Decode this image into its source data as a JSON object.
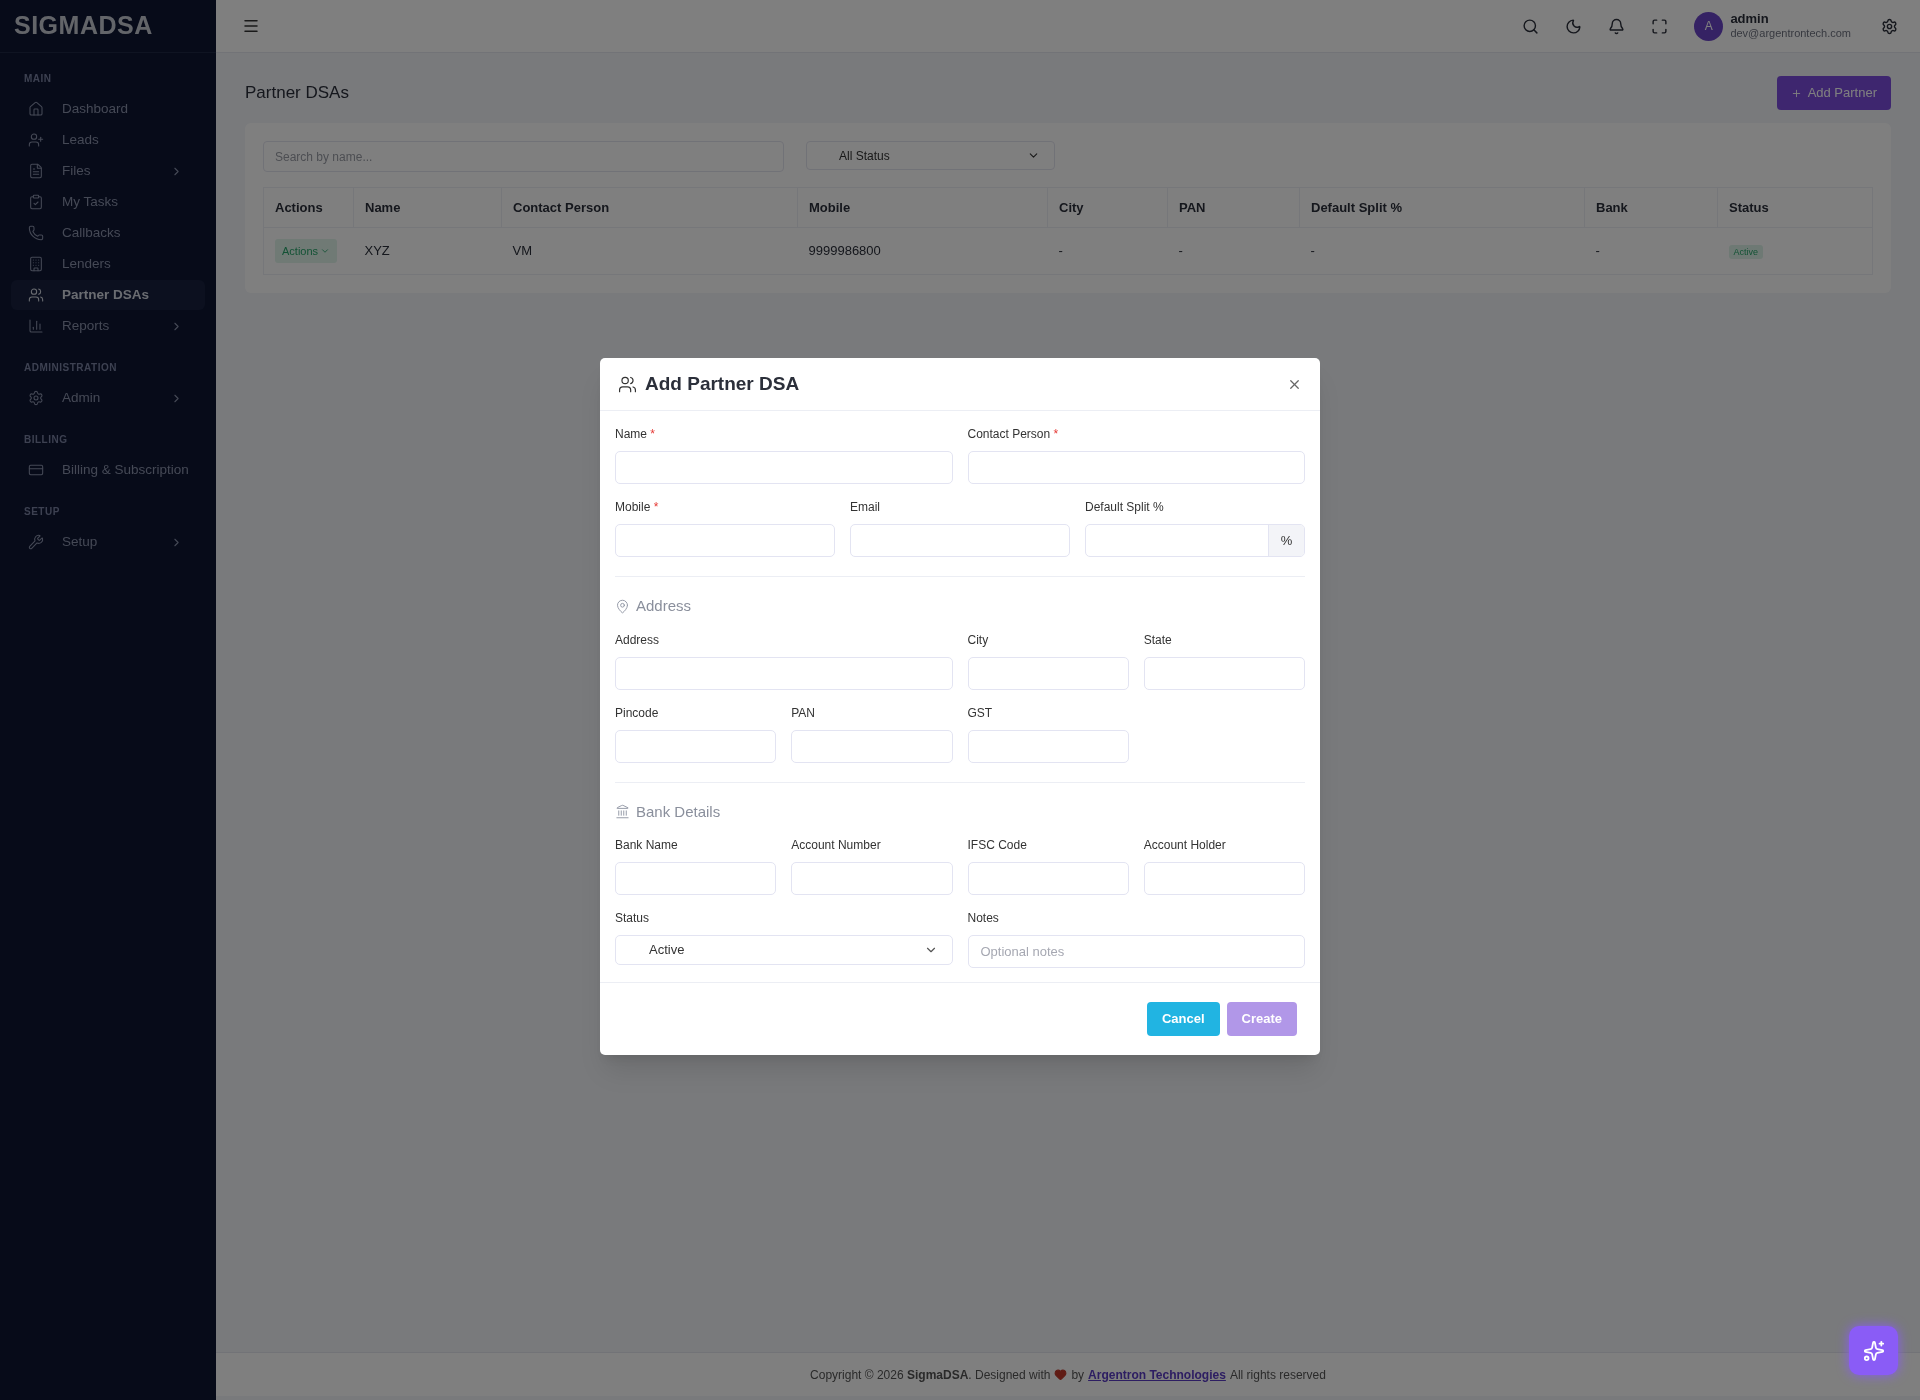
{
  "brand": "SIGMADSA",
  "sidebar": {
    "sections": [
      {
        "heading": "MAIN",
        "items": [
          {
            "label": "Dashboard",
            "submenu": false,
            "selected": false
          },
          {
            "label": "Leads",
            "submenu": false,
            "selected": false
          },
          {
            "label": "Files",
            "submenu": true,
            "selected": false
          },
          {
            "label": "My Tasks",
            "submenu": false,
            "selected": false
          },
          {
            "label": "Callbacks",
            "submenu": false,
            "selected": false
          },
          {
            "label": "Lenders",
            "submenu": false,
            "selected": false
          },
          {
            "label": "Partner DSAs",
            "submenu": false,
            "selected": true
          },
          {
            "label": "Reports",
            "submenu": true,
            "selected": false
          }
        ]
      },
      {
        "heading": "ADMINISTRATION",
        "items": [
          {
            "label": "Admin",
            "submenu": true,
            "selected": false
          }
        ]
      },
      {
        "heading": "BILLING",
        "items": [
          {
            "label": "Billing & Subscription",
            "submenu": false,
            "selected": false
          }
        ]
      },
      {
        "heading": "SETUP",
        "items": [
          {
            "label": "Setup",
            "submenu": true,
            "selected": false
          }
        ]
      }
    ]
  },
  "header": {
    "avatar": "A",
    "user": "admin",
    "email": "dev@argentrontech.com"
  },
  "page": {
    "title": "Partner DSAs",
    "add_button": "Add Partner",
    "search": {
      "placeholder": "Search by name..."
    },
    "status_filter": "All Status",
    "table": {
      "columns": [
        "Actions",
        "Name",
        "Contact Person",
        "Mobile",
        "City",
        "PAN",
        "Default Split %",
        "Bank",
        "Status"
      ],
      "rows": [
        {
          "cells": [
            "Actions",
            "XYZ",
            "VM",
            "9999986800",
            "-",
            "-",
            "-",
            "-",
            "Active"
          ]
        }
      ]
    }
  },
  "modal": {
    "title": "Add Partner DSA",
    "sections": [
      {
        "fields": [
          {
            "label": "Name",
            "required_mark": "*",
            "kind": "text"
          },
          {
            "label": "Contact Person",
            "required_mark": "*",
            "kind": "text"
          },
          {
            "label": "Mobile",
            "required_mark": "*",
            "kind": "text"
          },
          {
            "label": "Email",
            "kind": "text"
          },
          {
            "label": "Default Split %",
            "kind": "suffix",
            "suffix": "%"
          }
        ]
      },
      {
        "heading": "Address",
        "fields": [
          {
            "label": "Address",
            "kind": "text"
          },
          {
            "label": "City",
            "kind": "text"
          },
          {
            "label": "State",
            "kind": "text"
          },
          {
            "label": "Pincode",
            "kind": "text"
          },
          {
            "label": "PAN",
            "kind": "text"
          },
          {
            "label": "GST",
            "kind": "text"
          }
        ]
      },
      {
        "heading": "Bank Details",
        "fields": [
          {
            "label": "Bank Name",
            "kind": "text"
          },
          {
            "label": "Account Number",
            "kind": "text"
          },
          {
            "label": "IFSC Code",
            "kind": "text"
          },
          {
            "label": "Account Holder",
            "kind": "text"
          },
          {
            "label": "Status",
            "kind": "select",
            "value": "Active"
          },
          {
            "label": "Notes",
            "kind": "text",
            "placeholder": "Optional notes"
          }
        ]
      }
    ],
    "buttons": [
      {
        "label": "Cancel",
        "kind": "cancel",
        "disabled": false
      },
      {
        "label": "Create",
        "kind": "submit",
        "disabled": true
      }
    ]
  },
  "footer": {
    "before": "Copyright © 2026 **SigmaDSA**. Designed with",
    "by": "by",
    "link": "Argentron Technologies",
    "after": "All rights reserved"
  }
}
